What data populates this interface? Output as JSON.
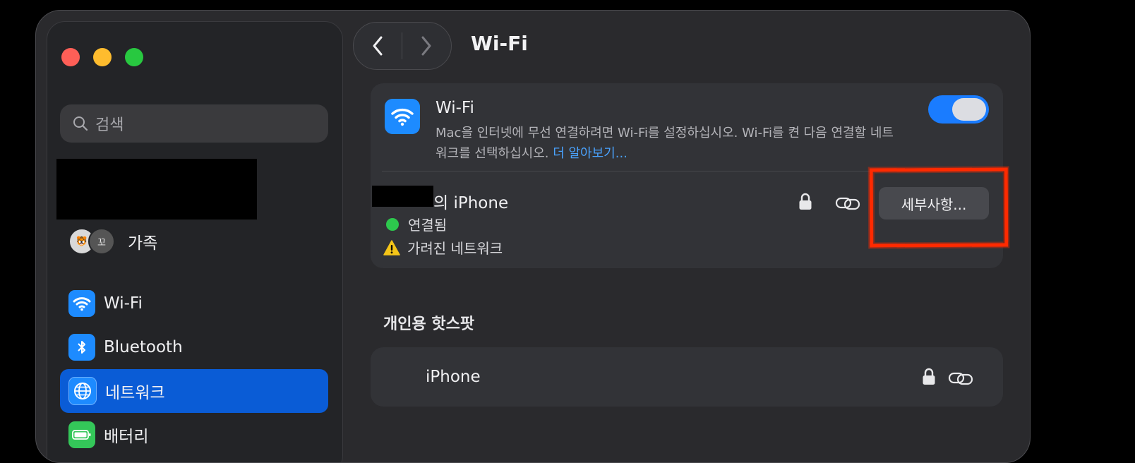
{
  "window": {
    "title": "Wi-Fi"
  },
  "sidebar": {
    "search_placeholder": "검색",
    "family": {
      "label": "가족",
      "avatars": [
        "🐯",
        "꼬"
      ]
    },
    "items": [
      {
        "label": "Wi-Fi",
        "icon": "wifi-icon",
        "color": "#1d8bff",
        "active": false
      },
      {
        "label": "Bluetooth",
        "icon": "bluetooth-icon",
        "color": "#1d8bff",
        "active": false
      },
      {
        "label": "네트워크",
        "icon": "globe-icon",
        "color": "#1d8bff",
        "active": true
      },
      {
        "label": "배터리",
        "icon": "battery-icon",
        "color": "#34c759",
        "active": false
      }
    ]
  },
  "wifi": {
    "name": "Wi-Fi",
    "description": "Mac을 인터넷에 무선 연결하려면 Wi-Fi를 설정하십시오. Wi-Fi를 켠 다음 연결할 네트워크를 선택하십시오.",
    "learn_more": "더 알아보기...",
    "enabled": true
  },
  "current_network": {
    "name_suffix": "의 iPhone",
    "status": "연결됨",
    "warning": "가려진 네트워크",
    "details_button": "세부사항..."
  },
  "personal_hotspot": {
    "section_title": "개인용 핫스팟",
    "networks": [
      {
        "name": "iPhone"
      }
    ]
  },
  "colors": {
    "accent": "#1a7cff",
    "connected": "#2dc84d",
    "annotation": "#ff2a00"
  }
}
